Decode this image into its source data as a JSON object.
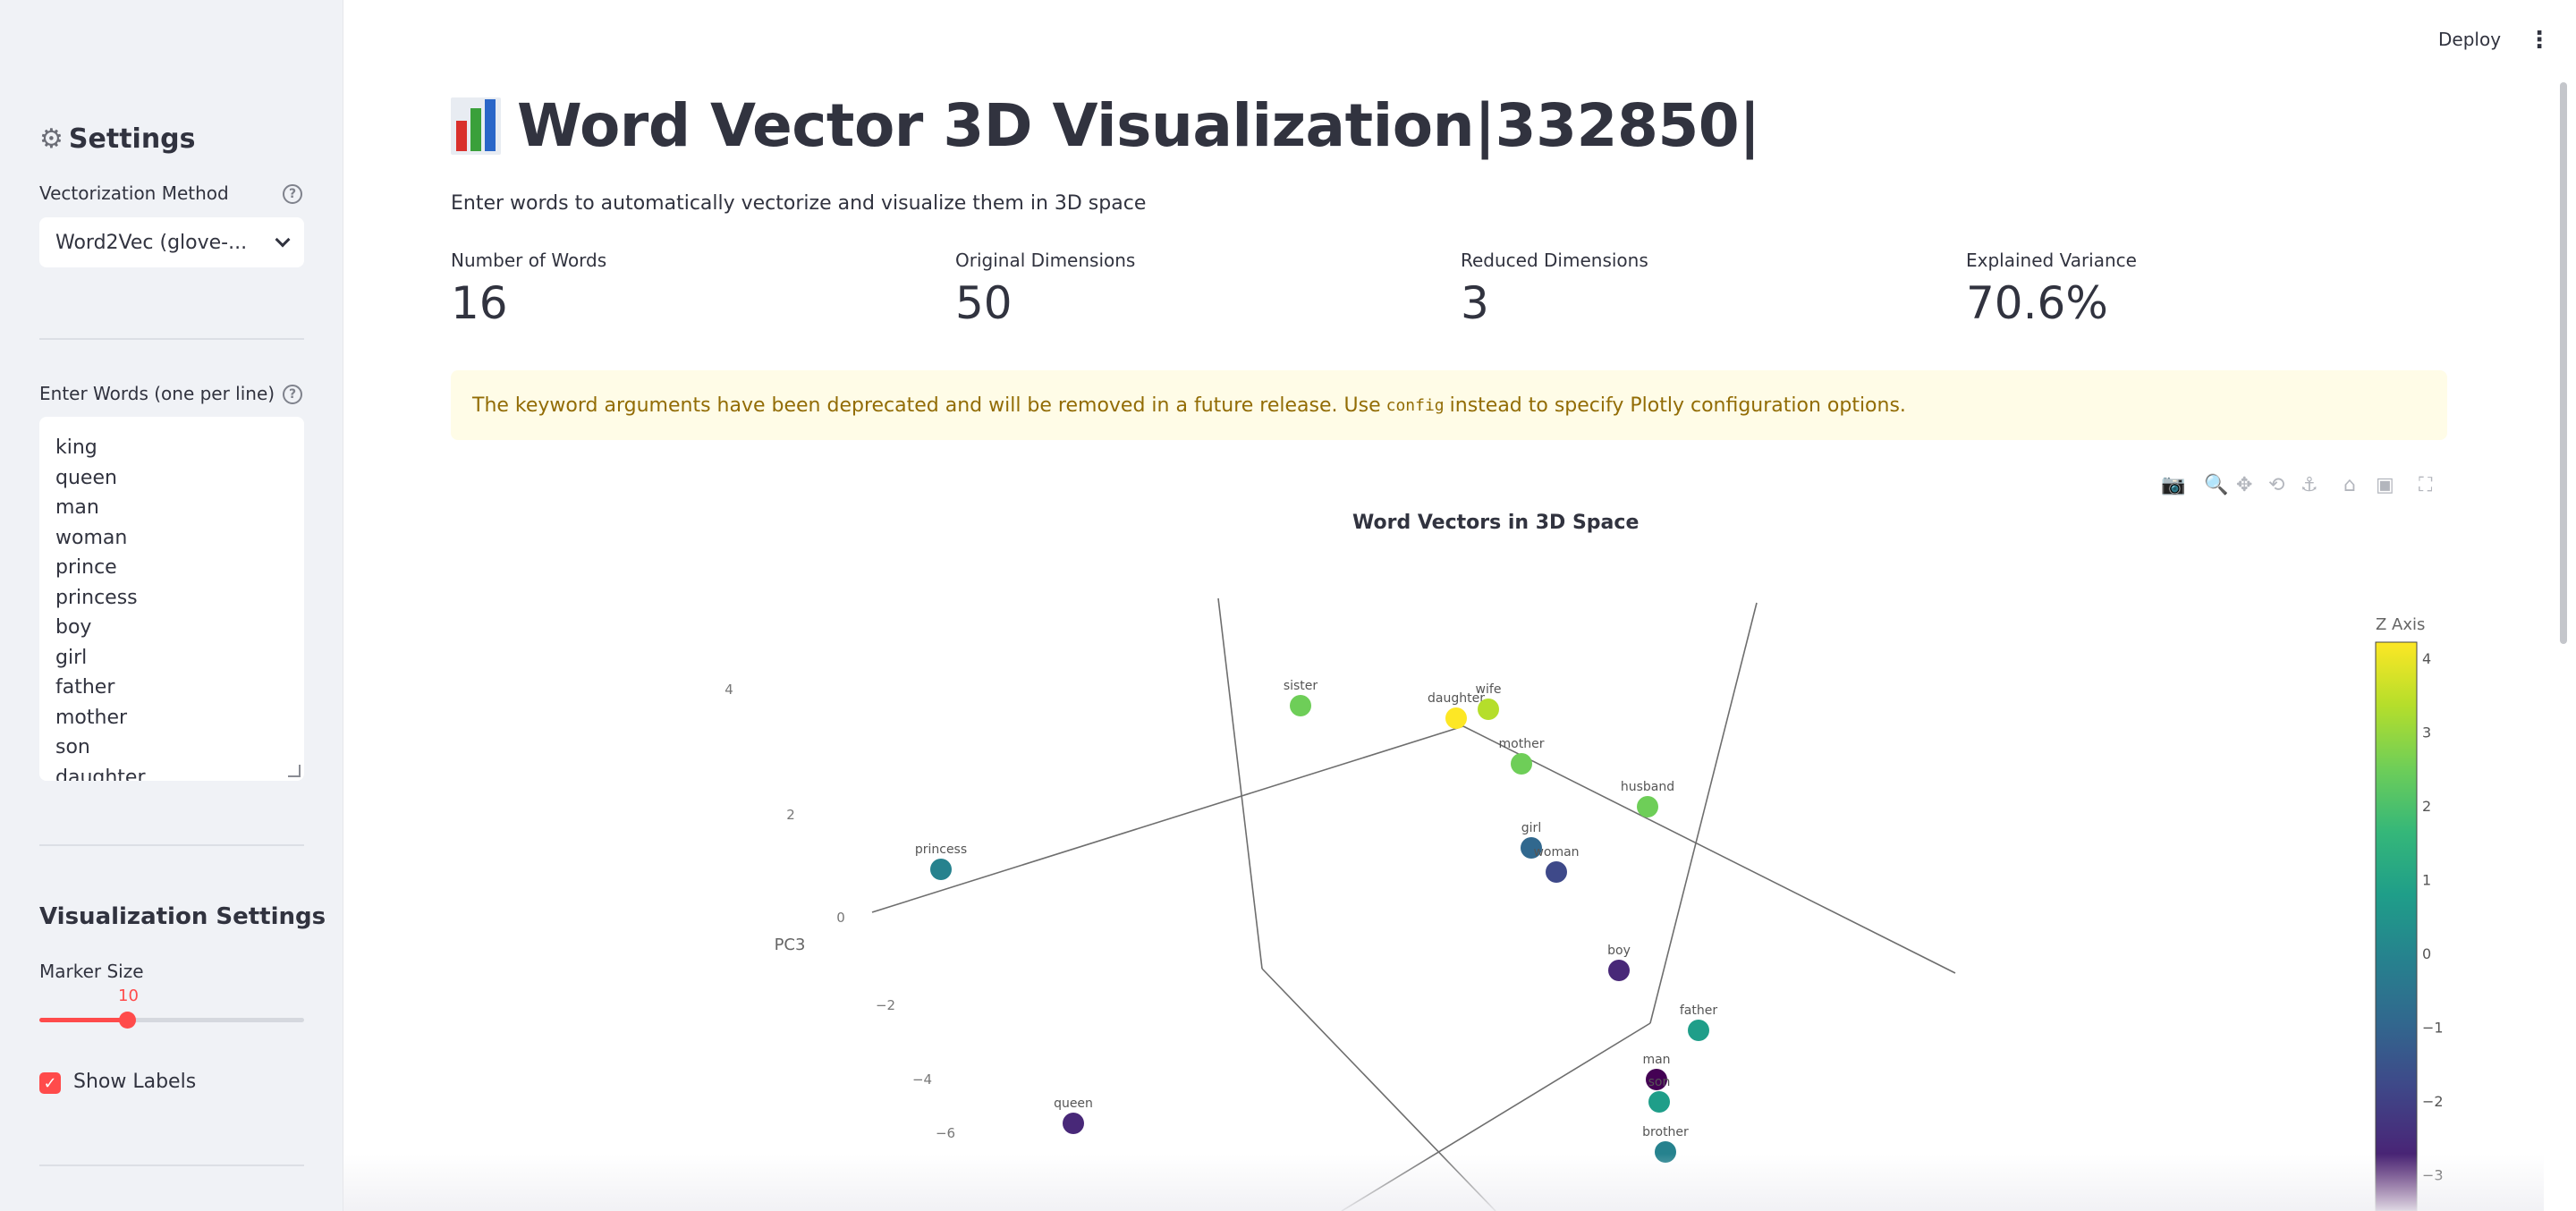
{
  "header": {
    "deploy_label": "Deploy",
    "menu_icon": "kebab-menu-icon"
  },
  "sidebar": {
    "title": "Settings",
    "vectorization_label": "Vectorization Method",
    "vectorization_value": "Word2Vec (glove-...",
    "words_label": "Enter Words (one per line)",
    "words_text": [
      "king",
      "queen",
      "man",
      "woman",
      "prince",
      "princess",
      "boy",
      "girl",
      "father",
      "mother",
      "son",
      "daughter"
    ],
    "viz_title": "Visualization Settings",
    "marker_label": "Marker Size",
    "marker_value": "10",
    "marker_fraction": 0.33,
    "show_labels_label": "Show Labels",
    "show_labels_checked": true
  },
  "main": {
    "title": "Word Vector 3D Visualization|332850|",
    "subtitle": "Enter words to automatically vectorize and visualize them in 3D space",
    "metrics": [
      {
        "label": "Number of Words",
        "value": "16"
      },
      {
        "label": "Original Dimensions",
        "value": "50"
      },
      {
        "label": "Reduced Dimensions",
        "value": "3"
      },
      {
        "label": "Explained Variance",
        "value": "70.6%"
      }
    ],
    "warning_pre": "The keyword arguments have been deprecated and will be removed in a future release. Use",
    "warning_code": "config",
    "warning_post": "instead to specify Plotly configuration options."
  },
  "colors": {
    "accent": "#ff4b4b",
    "warning_bg": "#fffce7",
    "warning_text": "#926c05",
    "sidebar_bg": "#f0f2f6"
  },
  "chart_data": {
    "type": "scatter3d",
    "title": "Word Vectors in 3D Space",
    "zlabel": "PC3",
    "colorbar_title": "Z Axis",
    "colorbar_ticks": [
      "4",
      "3",
      "2",
      "1",
      "0",
      "−1",
      "−2",
      "−3"
    ],
    "z_axis_ticks": [
      "4",
      "2",
      "0",
      "−2",
      "−4",
      "−6"
    ],
    "colorscale": "viridis",
    "points": [
      {
        "label": "sister",
        "z": 3.0
      },
      {
        "label": "daughter",
        "z": 4.2
      },
      {
        "label": "wife",
        "z": 4.0
      },
      {
        "label": "mother",
        "z": 2.2
      },
      {
        "label": "husband",
        "z": 2.6
      },
      {
        "label": "girl",
        "z": -1.5
      },
      {
        "label": "woman",
        "z": -1.8
      },
      {
        "label": "princess",
        "z": 0.0
      },
      {
        "label": "boy",
        "z": -3.5
      },
      {
        "label": "father",
        "z": 0.6
      },
      {
        "label": "man",
        "z": -3.8
      },
      {
        "label": "son",
        "z": 0.5
      },
      {
        "label": "brother",
        "z": -0.3
      },
      {
        "label": "queen",
        "z": -3.2
      }
    ]
  }
}
